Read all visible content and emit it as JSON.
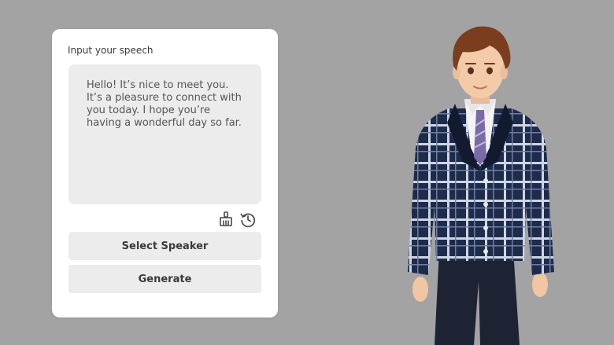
{
  "panel": {
    "label": "Input your speech",
    "speech_text": "Hello! It’s nice to meet you. It’s a pleasure to connect with you today. I hope you’re having a wonderful day so far."
  },
  "tools": {
    "clear_icon": "broom-icon",
    "history_icon": "history-icon"
  },
  "buttons": {
    "select_speaker": "Select Speaker",
    "generate": "Generate"
  },
  "colors": {
    "background": "#a3a3a3",
    "panel": "#ffffff",
    "field": "#ececec",
    "jacket": "#1f2b4a",
    "tie": "#7a6aa8"
  }
}
